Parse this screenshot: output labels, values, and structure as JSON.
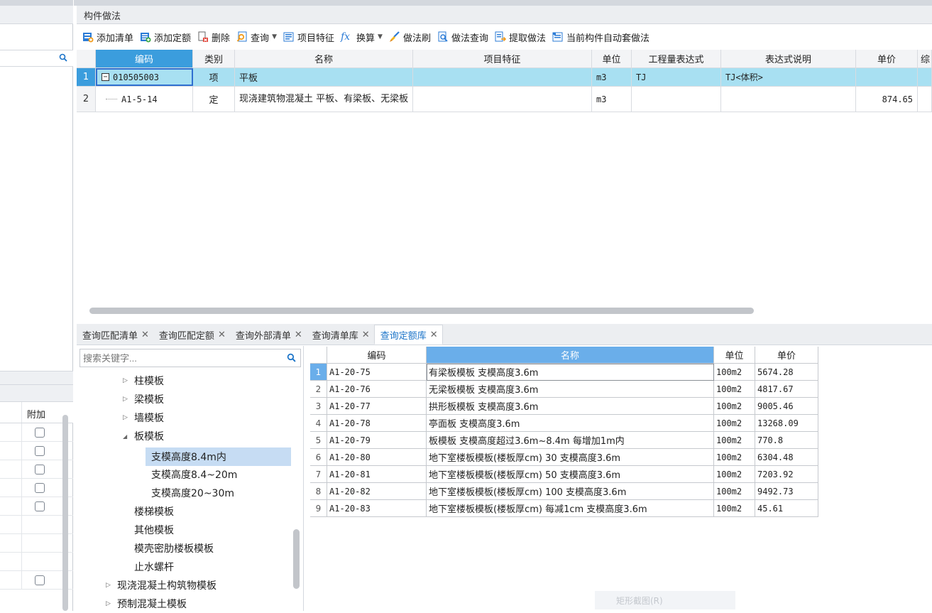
{
  "panel": {
    "title": "构件做法"
  },
  "toolbar": {
    "add_list": "添加清单",
    "add_quota": "添加定额",
    "delete": "删除",
    "query": "查询",
    "item_feature": "项目特征",
    "convert": "换算",
    "brush": "做法刷",
    "method_query": "做法查询",
    "extract": "提取做法",
    "auto_apply": "当前构件自动套做法"
  },
  "top_grid": {
    "headers": [
      "编码",
      "类别",
      "名称",
      "项目特征",
      "单位",
      "工程量表达式",
      "表达式说明",
      "单价",
      "综"
    ],
    "rows": [
      {
        "num": "1",
        "code": "010505003",
        "type": "项",
        "name": "平板",
        "feature": "",
        "unit": "m3",
        "expr": "TJ",
        "expr_desc": "TJ<体积>",
        "price": ""
      },
      {
        "num": "2",
        "code": "A1-5-14",
        "type": "定",
        "name": "现浇建筑物混凝土 平板、有梁板、无梁板",
        "feature": "",
        "unit": "m3",
        "expr": "",
        "expr_desc": "",
        "price": "874.65"
      }
    ]
  },
  "tabs": [
    {
      "label": "查询匹配清单",
      "active": false
    },
    {
      "label": "查询匹配定额",
      "active": false
    },
    {
      "label": "查询外部清单",
      "active": false
    },
    {
      "label": "查询清单库",
      "active": false
    },
    {
      "label": "查询定额库",
      "active": true
    }
  ],
  "tree": {
    "search_placeholder": "搜索关键字...",
    "nodes": [
      {
        "label": "柱模板",
        "arrow": "▷"
      },
      {
        "label": "梁模板",
        "arrow": "▷"
      },
      {
        "label": "墙模板",
        "arrow": "▷"
      },
      {
        "label": "板模板",
        "arrow": "◢"
      },
      {
        "label": "支模高度8.4m内",
        "arrow": ""
      },
      {
        "label": "支模高度8.4~20m",
        "arrow": ""
      },
      {
        "label": "支模高度20~30m",
        "arrow": ""
      },
      {
        "label": "楼梯模板",
        "arrow": ""
      },
      {
        "label": "其他模板",
        "arrow": ""
      },
      {
        "label": "模壳密肋楼板模板",
        "arrow": ""
      },
      {
        "label": "止水螺杆",
        "arrow": ""
      },
      {
        "label": "现浇混凝土构筑物模板",
        "arrow": "▷"
      },
      {
        "label": "预制混凝土模板",
        "arrow": "▷"
      }
    ]
  },
  "quota_grid": {
    "headers": [
      "编码",
      "名称",
      "单位",
      "单价"
    ],
    "rows": [
      {
        "num": "1",
        "code": "A1-20-75",
        "name": "有梁板模板 支模高度3.6m",
        "unit": "100m2",
        "price": "5674.28"
      },
      {
        "num": "2",
        "code": "A1-20-76",
        "name": "无梁板模板 支模高度3.6m",
        "unit": "100m2",
        "price": "4817.67"
      },
      {
        "num": "3",
        "code": "A1-20-77",
        "name": "拱形板模板 支模高度3.6m",
        "unit": "100m2",
        "price": "9005.46"
      },
      {
        "num": "4",
        "code": "A1-20-78",
        "name": "亭面板 支模高度3.6m",
        "unit": "100m2",
        "price": "13268.09"
      },
      {
        "num": "5",
        "code": "A1-20-79",
        "name": "板模板 支模高度超过3.6m~8.4m 每增加1m内",
        "unit": "100m2",
        "price": "770.8"
      },
      {
        "num": "6",
        "code": "A1-20-80",
        "name": "地下室楼板模板(楼板厚cm) 30 支模高度3.6m",
        "unit": "100m2",
        "price": "6304.48"
      },
      {
        "num": "7",
        "code": "A1-20-81",
        "name": "地下室楼板模板(楼板厚cm) 50 支模高度3.6m",
        "unit": "100m2",
        "price": "7203.92"
      },
      {
        "num": "8",
        "code": "A1-20-82",
        "name": "地下室楼板模板(楼板厚cm) 100 支模高度3.6m",
        "unit": "100m2",
        "price": "9492.73"
      },
      {
        "num": "9",
        "code": "A1-20-83",
        "name": "地下室楼板模板(楼板厚cm) 每减1cm 支模高度3.6m",
        "unit": "100m2",
        "price": "45.61"
      }
    ]
  },
  "left": {
    "extra_header": "附加"
  },
  "ghost_button": "矩形截图(R)"
}
